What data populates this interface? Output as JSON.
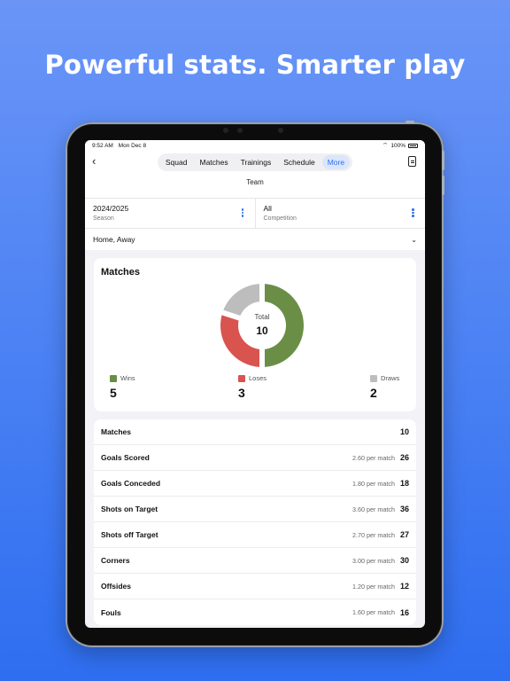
{
  "headline": "Powerful stats. Smarter play",
  "status": {
    "time": "9:52 AM",
    "date": "Mon Dec 8",
    "battery": "100%"
  },
  "nav": {
    "back_icon": "chevron-left-icon",
    "tabs": [
      {
        "label": "Squad",
        "active": false
      },
      {
        "label": "Matches",
        "active": false
      },
      {
        "label": "Trainings",
        "active": false
      },
      {
        "label": "Schedule",
        "active": false
      },
      {
        "label": "More",
        "active": true
      }
    ],
    "export_icon": "document-icon"
  },
  "subtitle": "Team",
  "filters": {
    "season": {
      "value": "2024/2025",
      "label": "Season"
    },
    "competition": {
      "value": "All",
      "label": "Competition"
    },
    "venue": "Home, Away"
  },
  "matches_card": {
    "title": "Matches",
    "total_label": "Total",
    "total_value": "10",
    "wins_label": "Wins",
    "wins": 5,
    "loses_label": "Loses",
    "loses": 3,
    "draws_label": "Draws",
    "draws": 2,
    "colors": {
      "wins": "#6b8e47",
      "loses": "#d9534f",
      "draws": "#bdbdbd"
    }
  },
  "stats": [
    {
      "label": "Matches",
      "per": "",
      "total": "10"
    },
    {
      "label": "Goals Scored",
      "per": "2.60 per match",
      "total": "26"
    },
    {
      "label": "Goals Conceded",
      "per": "1.80 per match",
      "total": "18"
    },
    {
      "label": "Shots on Target",
      "per": "3.60 per match",
      "total": "36"
    },
    {
      "label": "Shots off Target",
      "per": "2.70 per match",
      "total": "27"
    },
    {
      "label": "Corners",
      "per": "3.00 per match",
      "total": "30"
    },
    {
      "label": "Offsides",
      "per": "1.20 per match",
      "total": "12"
    },
    {
      "label": "Fouls",
      "per": "1.60 per match",
      "total": "16"
    }
  ],
  "accent": "#2f6fe8"
}
